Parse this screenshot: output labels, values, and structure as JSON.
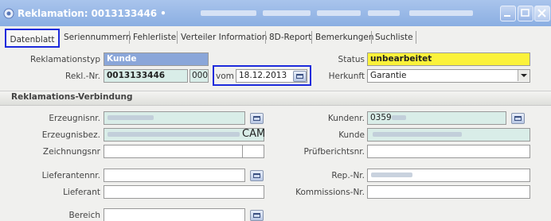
{
  "window": {
    "title_prefix": "Reklamation:",
    "title_number": "0013133446",
    "colors": {
      "titlebar": "#8aaee2",
      "highlight": "#1d2bdc",
      "status_bg": "#fbf23a",
      "selected_bg": "#8aa6d9"
    }
  },
  "tabs": [
    {
      "label": "Datenblatt",
      "active": true
    },
    {
      "label": "Seriennummern"
    },
    {
      "label": "Fehlerliste"
    },
    {
      "label": "Verteiler Information"
    },
    {
      "label": "8D-Report"
    },
    {
      "label": "Bemerkungen"
    },
    {
      "label": "Suchliste"
    }
  ],
  "header_form": {
    "typ_label": "Reklamationstyp",
    "typ_value": "Kunde",
    "nr_label": "Rekl.-Nr.",
    "nr_value": "0013133446",
    "nr_suffix": "000",
    "vom_label": "vom",
    "vom_value": "18.12.2013",
    "status_label": "Status",
    "status_value": "unbearbeitet",
    "herkunft_label": "Herkunft",
    "herkunft_value": "Garantie"
  },
  "section": {
    "title": "Reklamations-Verbindung"
  },
  "left_fields": {
    "erzeugnisnr_label": "Erzeugnisnr.",
    "erzeugnisbez_label": "Erzeugnisbez.",
    "erzeugnisbez_value_tail": "CAM",
    "zeichnungsnr_label": "Zeichnungsnr",
    "lieferantennr_label": "Lieferantennr.",
    "lieferant_label": "Lieferant",
    "bereich_label": "Bereich"
  },
  "right_fields": {
    "kundennr_label": "Kundenr.",
    "kundennr_value": "0359",
    "kunde_label": "Kunde",
    "pruefbericht_label": "Prüfberichtsnr.",
    "repnr_label": "Rep.-Nr.",
    "kommission_label": "Kommissions-Nr."
  }
}
